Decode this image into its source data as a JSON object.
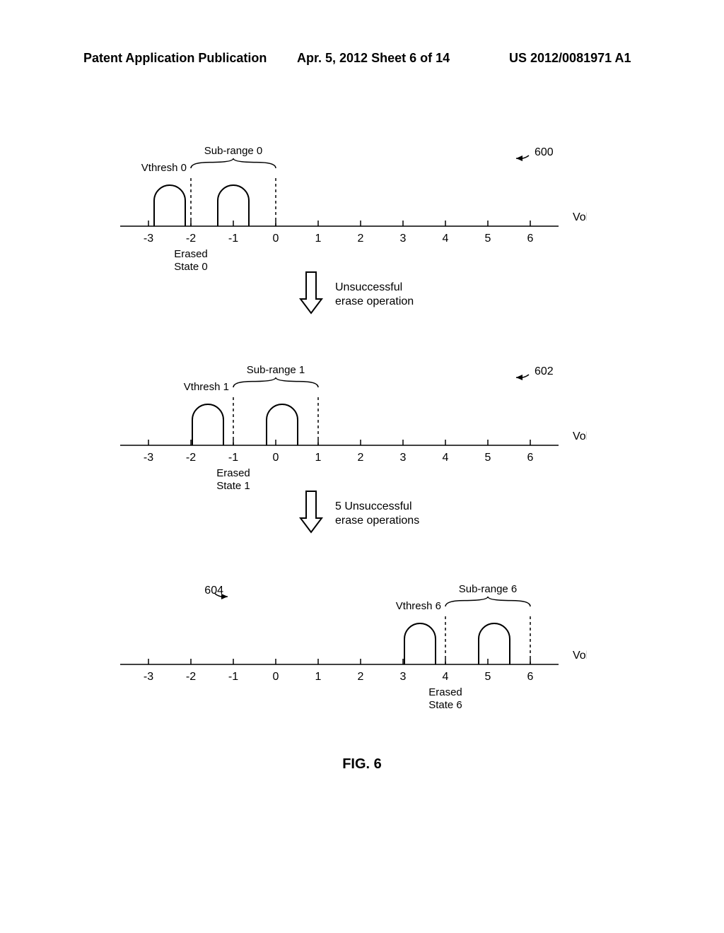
{
  "header": {
    "left": "Patent Application Publication",
    "mid": "Apr. 5, 2012   Sheet 6 of 14",
    "right": "US 2012/0081971 A1"
  },
  "figure_label": "FIG. 6",
  "axes_ticks": [
    "-3",
    "-2",
    "-1",
    "0",
    "1",
    "2",
    "3",
    "4",
    "5",
    "6"
  ],
  "axis_label": "Volts",
  "panels": [
    {
      "ref": "600",
      "subrange_label": "Sub-range 0",
      "vthresh_label": "Vthresh 0",
      "erased_label_line1": "Erased",
      "erased_label_line2": "State 0",
      "vthresh_tick_index": 1,
      "subrange_right_tick_index": 3,
      "hump1_center_tick": 0.5,
      "hump2_center_tick": 2.0,
      "erased_center_tick": 1
    },
    {
      "ref": "602",
      "subrange_label": "Sub-range 1",
      "vthresh_label": "Vthresh 1",
      "erased_label_line1": "Erased",
      "erased_label_line2": "State 1",
      "vthresh_tick_index": 2,
      "subrange_right_tick_index": 4,
      "hump1_center_tick": 1.4,
      "hump2_center_tick": 3.15,
      "erased_center_tick": 2
    },
    {
      "ref": "604",
      "subrange_label": "Sub-range 6",
      "vthresh_label": "Vthresh 6",
      "erased_label_line1": "Erased",
      "erased_label_line2": "State 6",
      "vthresh_tick_index": 7,
      "subrange_right_tick_index": 9,
      "hump1_center_tick": 6.4,
      "hump2_center_tick": 8.15,
      "erased_center_tick": 7,
      "ref_on_left": true
    }
  ],
  "arrows": [
    {
      "label_line1": "Unsuccessful",
      "label_line2": "erase operation"
    },
    {
      "label_line1": "5 Unsuccessful",
      "label_line2": "erase operations"
    }
  ]
}
